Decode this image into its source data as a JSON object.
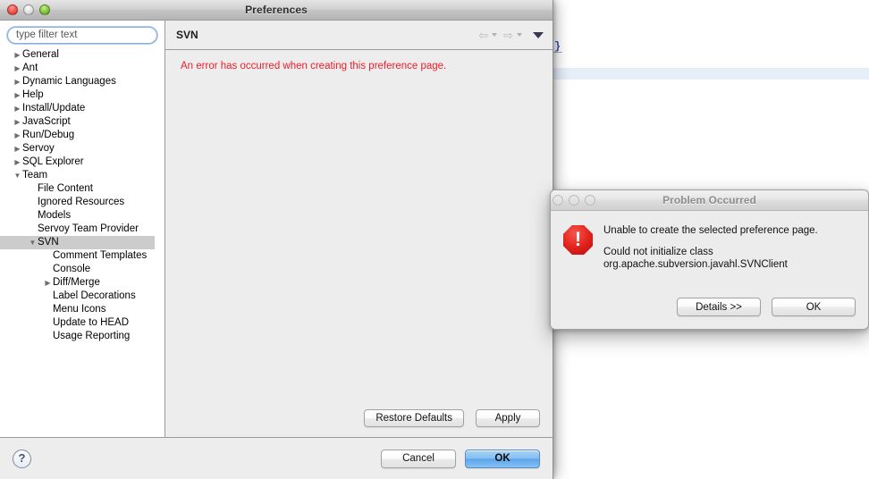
{
  "background_editor": {
    "brace_text": "}"
  },
  "preferences_window": {
    "title": "Preferences",
    "traffic_lights": {
      "close": "close-button",
      "minimize": "minimize-button",
      "zoom": "zoom-button"
    },
    "filter": {
      "placeholder": "type filter text",
      "value": ""
    },
    "tree": [
      {
        "label": "General",
        "depth": 0,
        "twisty": "collapsed",
        "selected": false
      },
      {
        "label": "Ant",
        "depth": 0,
        "twisty": "collapsed",
        "selected": false
      },
      {
        "label": "Dynamic Languages",
        "depth": 0,
        "twisty": "collapsed",
        "selected": false
      },
      {
        "label": "Help",
        "depth": 0,
        "twisty": "collapsed",
        "selected": false
      },
      {
        "label": "Install/Update",
        "depth": 0,
        "twisty": "collapsed",
        "selected": false
      },
      {
        "label": "JavaScript",
        "depth": 0,
        "twisty": "collapsed",
        "selected": false
      },
      {
        "label": "Run/Debug",
        "depth": 0,
        "twisty": "collapsed",
        "selected": false
      },
      {
        "label": "Servoy",
        "depth": 0,
        "twisty": "collapsed",
        "selected": false
      },
      {
        "label": "SQL Explorer",
        "depth": 0,
        "twisty": "collapsed",
        "selected": false
      },
      {
        "label": "Team",
        "depth": 0,
        "twisty": "expanded",
        "selected": false
      },
      {
        "label": "File Content",
        "depth": 1,
        "twisty": "empty",
        "selected": false
      },
      {
        "label": "Ignored Resources",
        "depth": 1,
        "twisty": "empty",
        "selected": false
      },
      {
        "label": "Models",
        "depth": 1,
        "twisty": "empty",
        "selected": false
      },
      {
        "label": "Servoy Team Provider",
        "depth": 1,
        "twisty": "empty",
        "selected": false
      },
      {
        "label": "SVN",
        "depth": 1,
        "twisty": "expanded",
        "selected": true
      },
      {
        "label": "Comment Templates",
        "depth": 2,
        "twisty": "empty",
        "selected": false
      },
      {
        "label": "Console",
        "depth": 2,
        "twisty": "empty",
        "selected": false
      },
      {
        "label": "Diff/Merge",
        "depth": 2,
        "twisty": "collapsed",
        "selected": false
      },
      {
        "label": "Label Decorations",
        "depth": 2,
        "twisty": "empty",
        "selected": false
      },
      {
        "label": "Menu Icons",
        "depth": 2,
        "twisty": "empty",
        "selected": false
      },
      {
        "label": "Update to HEAD",
        "depth": 2,
        "twisty": "empty",
        "selected": false
      },
      {
        "label": "Usage Reporting",
        "depth": 2,
        "twisty": "empty",
        "selected": false
      }
    ],
    "content": {
      "title": "SVN",
      "error_message": "An error has occurred when creating this preference page.",
      "error_color": "#ee1c2b",
      "toolbar": {
        "back_icon": "back-arrow-icon",
        "back_caret": "chevron-down-icon",
        "forward_icon": "forward-arrow-icon",
        "forward_caret": "chevron-down-icon",
        "menu_caret": "view-menu-icon"
      },
      "restore_defaults_label": "Restore Defaults",
      "apply_label": "Apply"
    },
    "footer": {
      "help_label": "?",
      "cancel_label": "Cancel",
      "ok_label": "OK"
    }
  },
  "problem_dialog": {
    "title": "Problem Occurred",
    "icon": "error-octagon-icon",
    "message_primary": "Unable to create the selected preference page.",
    "message_secondary_line1": "Could not initialize class",
    "message_secondary_line2": "org.apache.subversion.javahl.SVNClient",
    "details_label": "Details >>",
    "ok_label": "OK"
  }
}
